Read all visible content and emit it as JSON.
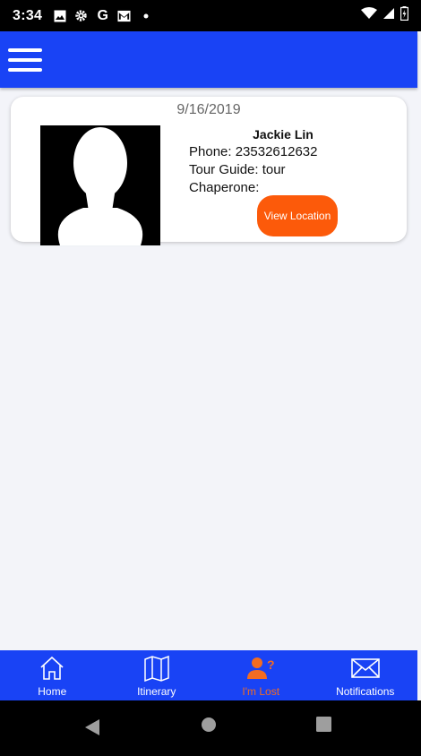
{
  "status_bar": {
    "time": "3:34",
    "icons": [
      "photo-icon",
      "settings-gear-icon",
      "google-g-icon",
      "gmail-icon",
      "dot-icon"
    ],
    "right_icons": [
      "wifi-icon",
      "signal-icon",
      "battery-charging-icon"
    ]
  },
  "app_bar": {
    "menu_icon": "hamburger-menu-icon"
  },
  "card": {
    "date": "9/16/2019",
    "name": "Jackie Lin",
    "phone": "Phone: 23532612632",
    "tour_guide": "Tour Guide: tour",
    "chaperone": "Chaperone:",
    "button_label": "View Location",
    "button_color": "#fc5a0a"
  },
  "bottom_nav": {
    "items": [
      {
        "label": "Home",
        "icon": "home-icon"
      },
      {
        "label": "Itinerary",
        "icon": "map-icon"
      },
      {
        "label": "I'm Lost",
        "icon": "lost-person-icon"
      },
      {
        "label": "Notifications",
        "icon": "envelope-icon"
      }
    ],
    "active_color": "#f26c22",
    "bar_color": "#1943f5"
  },
  "system_nav": {
    "buttons": [
      "back-icon",
      "home-circle-icon",
      "recents-icon"
    ]
  }
}
